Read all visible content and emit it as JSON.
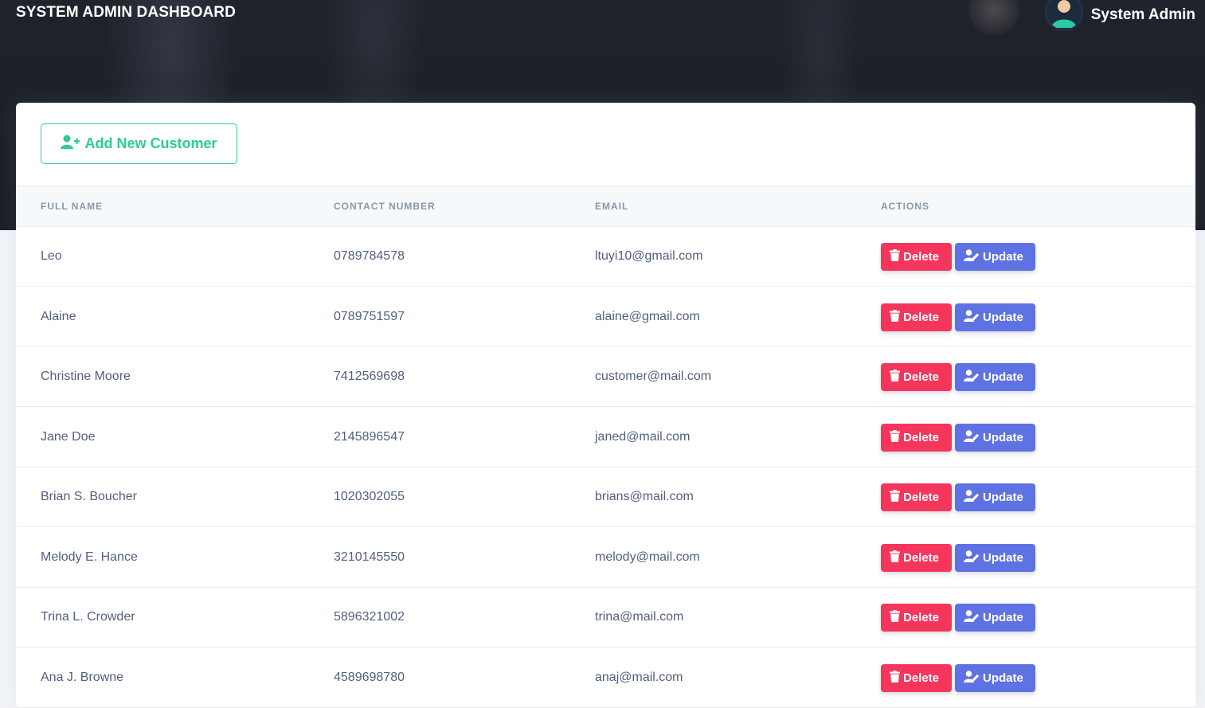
{
  "header": {
    "title": "SYSTEM ADMIN DASHBOARD",
    "user_name": "System Admin"
  },
  "toolbar": {
    "add_label": "Add New Customer"
  },
  "table": {
    "columns": [
      "FULL NAME",
      "CONTACT NUMBER",
      "EMAIL",
      "ACTIONS"
    ],
    "delete_label": "Delete",
    "update_label": "Update",
    "rows": [
      {
        "name": "Leo",
        "contact": "0789784578",
        "email": "ltuyi10@gmail.com"
      },
      {
        "name": "Alaine",
        "contact": "0789751597",
        "email": "alaine@gmail.com"
      },
      {
        "name": "Christine Moore",
        "contact": "7412569698",
        "email": "customer@mail.com"
      },
      {
        "name": "Jane Doe",
        "contact": "2145896547",
        "email": "janed@mail.com"
      },
      {
        "name": "Brian S. Boucher",
        "contact": "1020302055",
        "email": "brians@mail.com"
      },
      {
        "name": "Melody E. Hance",
        "contact": "3210145550",
        "email": "melody@mail.com"
      },
      {
        "name": "Trina L. Crowder",
        "contact": "5896321002",
        "email": "trina@mail.com"
      },
      {
        "name": "Ana J. Browne",
        "contact": "4589698780",
        "email": "anaj@mail.com"
      }
    ]
  },
  "icons": {
    "add": "user-plus-icon",
    "delete": "trash-icon",
    "update": "user-edit-icon",
    "avatar": "user-avatar-icon"
  },
  "colors": {
    "success": "#2dce89",
    "danger": "#f5365c",
    "primary": "#5e72e4",
    "header_bg": "#1c1f27"
  }
}
